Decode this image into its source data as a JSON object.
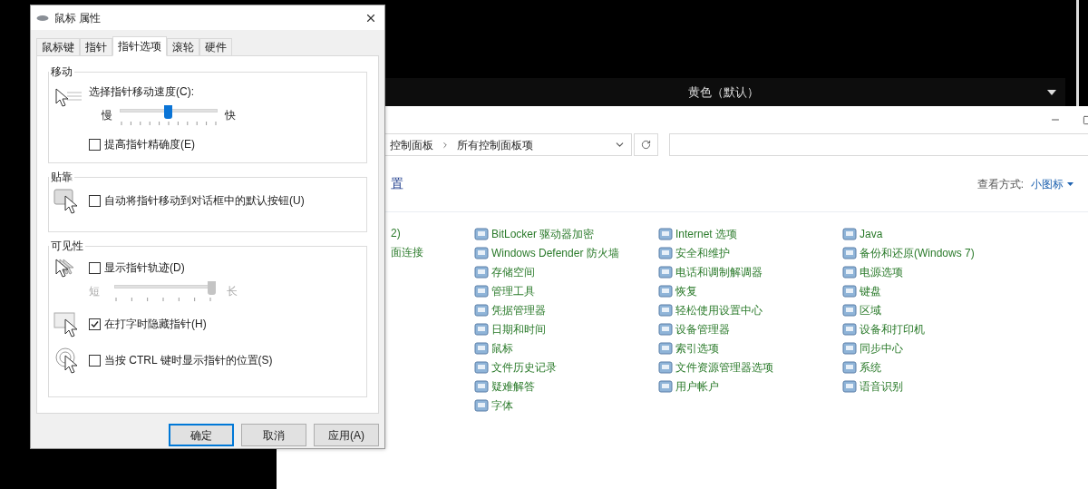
{
  "background_app": {
    "dropdown": "黄色（默认）"
  },
  "control_panel": {
    "breadcrumb": [
      "控制面板",
      "所有控制面板项"
    ],
    "heading_fragment": "置",
    "view_label": "查看方式:",
    "view_value": "小图标",
    "partial_items": [
      "2)",
      "面连接"
    ],
    "columns": [
      [
        "BitLocker 驱动器加密",
        "Windows Defender 防火墙",
        "存储空间",
        "管理工具",
        "凭据管理器",
        "日期和时间",
        "鼠标",
        "文件历史记录",
        "疑难解答",
        "字体"
      ],
      [
        "Internet 选项",
        "安全和维护",
        "电话和调制解调器",
        "恢复",
        "轻松使用设置中心",
        "设备管理器",
        "索引选项",
        "文件资源管理器选项",
        "用户帐户"
      ],
      [
        "Java",
        "备份和还原(Windows 7)",
        "电源选项",
        "键盘",
        "区域",
        "设备和打印机",
        "同步中心",
        "系统",
        "语音识别"
      ]
    ]
  },
  "dialog": {
    "title": "鼠标 属性",
    "tabs": [
      {
        "label": "鼠标键",
        "selected": false
      },
      {
        "label": "指针",
        "selected": false
      },
      {
        "label": "指针选项",
        "selected": true
      },
      {
        "label": "滚轮",
        "selected": false
      },
      {
        "label": "硬件",
        "selected": false
      }
    ],
    "motion": {
      "title": "移动",
      "speed_label": "选择指针移动速度(C):",
      "slow": "慢",
      "fast": "快",
      "speed": {
        "level": 0.5,
        "disabled": false
      },
      "precision": {
        "label": "提高指针精确度(E)",
        "checked": false
      }
    },
    "snap": {
      "title": "贴靠",
      "option": {
        "label": "自动将指针移动到对话框中的默认按钮(U)",
        "checked": false
      }
    },
    "visibility": {
      "title": "可见性",
      "trails": {
        "label": "显示指针轨迹(D)",
        "checked": false
      },
      "short": "短",
      "long": "长",
      "trail_length": {
        "level": 1,
        "disabled": true
      },
      "hide": {
        "label": "在打字时隐藏指针(H)",
        "checked": true
      },
      "ctrl": {
        "label": "当按 CTRL 键时显示指针的位置(S)",
        "checked": false
      }
    },
    "buttons": [
      {
        "label": "确定",
        "default": true
      },
      {
        "label": "取消",
        "default": false
      },
      {
        "label": "应用(A)",
        "default": false
      }
    ]
  }
}
